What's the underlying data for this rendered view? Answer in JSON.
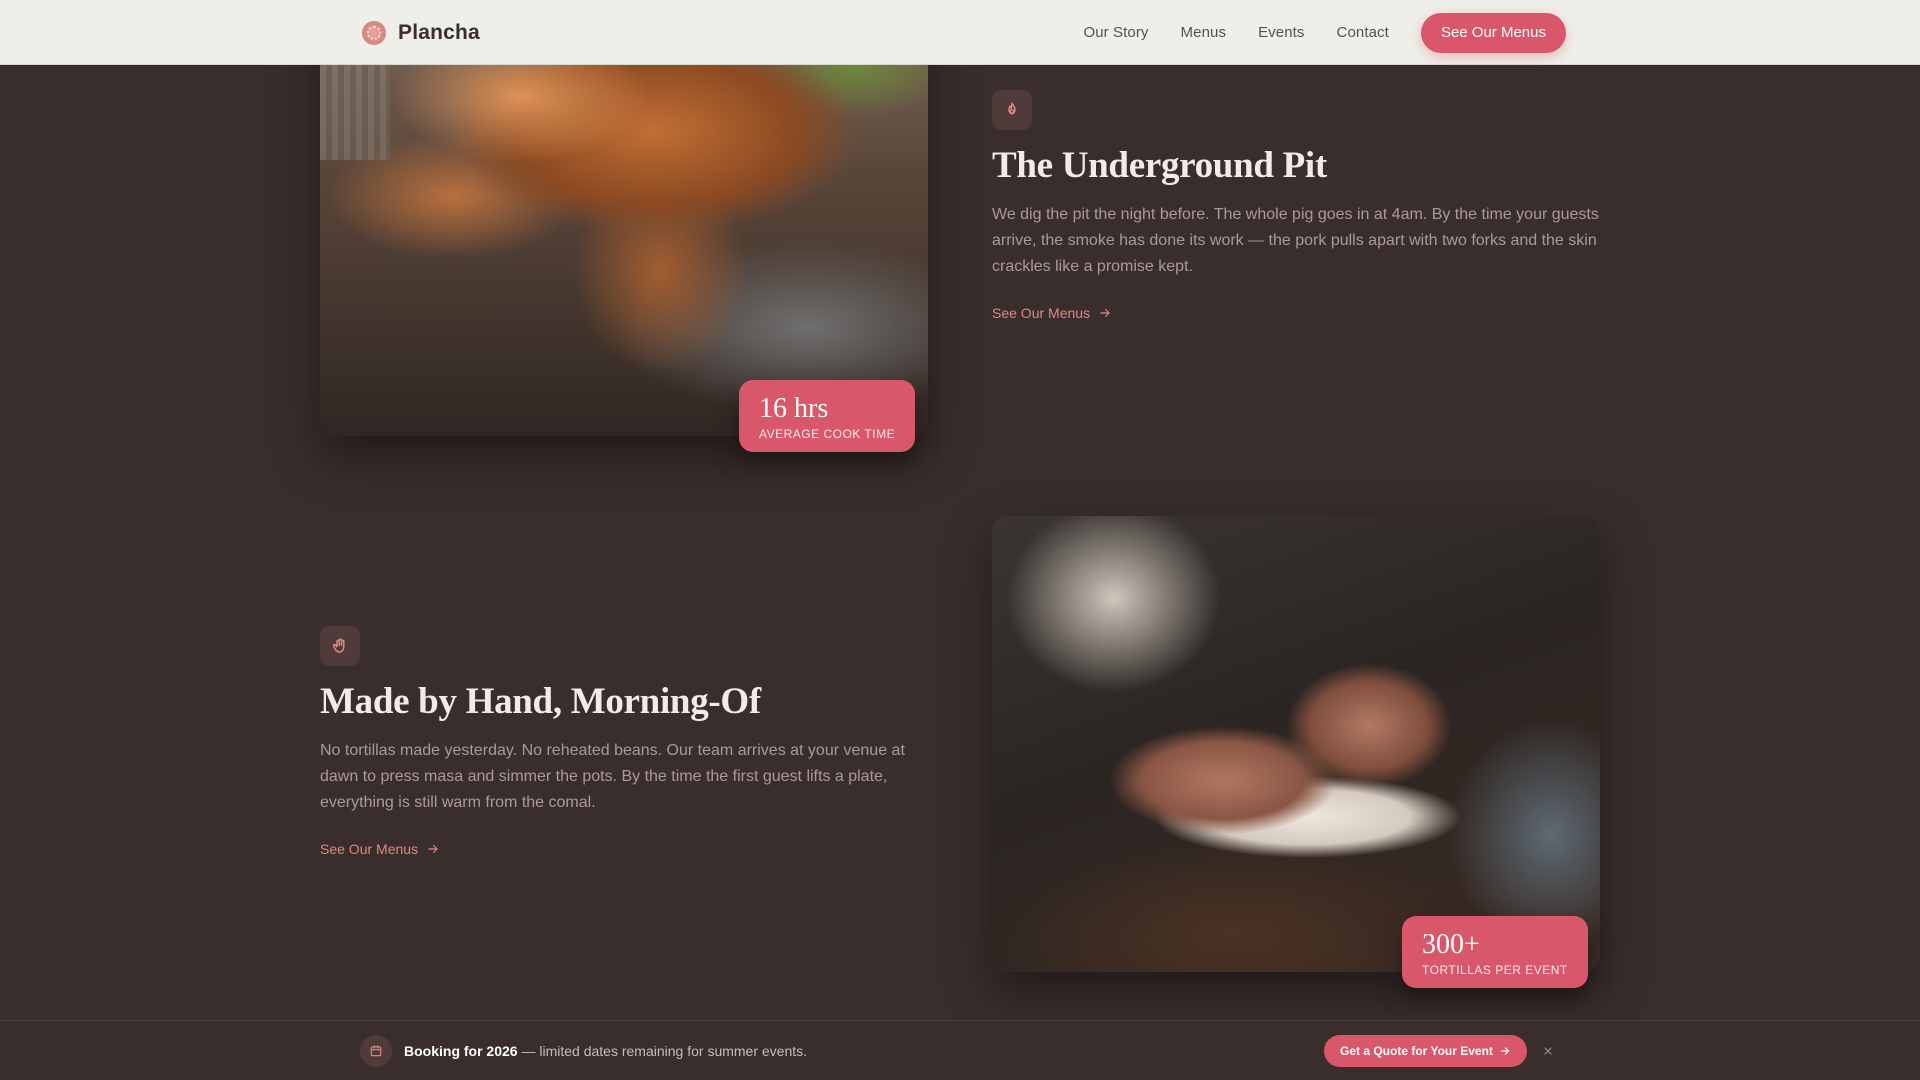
{
  "header": {
    "brand_name": "Plancha",
    "nav": [
      "Our Story",
      "Menus",
      "Events",
      "Contact"
    ],
    "cta_label": "See Our Menus"
  },
  "features": [
    {
      "icon": "flame-icon",
      "title": "The Underground Pit",
      "body": "We dig the pit the night before. The whole pig goes in at 4am. By the time your guests arrive, the smoke has done its work — the pork pulls apart with two forks and the skin crackles like a promise kept.",
      "link_label": "See Our Menus",
      "stat_value": "16 hrs",
      "stat_label": "AVERAGE COOK TIME"
    },
    {
      "icon": "hand-icon",
      "title": "Made by Hand, Morning-Of",
      "body": "No tortillas made yesterday. No reheated beans. Our team arrives at your venue at dawn to press masa and simmer the pots. By the time the first guest lifts a plate, everything is still warm from the comal.",
      "link_label": "See Our Menus",
      "stat_value": "300+",
      "stat_label": "TORTILLAS PER EVENT"
    }
  ],
  "booking_bar": {
    "icon": "calendar-icon",
    "strong_text": "Booking for 2026",
    "rest_text": " — limited dates remaining for summer events.",
    "cta_label": "Get a Quote for Your Event",
    "close_icon": "close-icon"
  },
  "colors": {
    "background": "#3a2e2d",
    "header_bg": "#efefe9",
    "accent": "#d9576a",
    "link": "#e0877f",
    "body_text": "#a99b97"
  }
}
